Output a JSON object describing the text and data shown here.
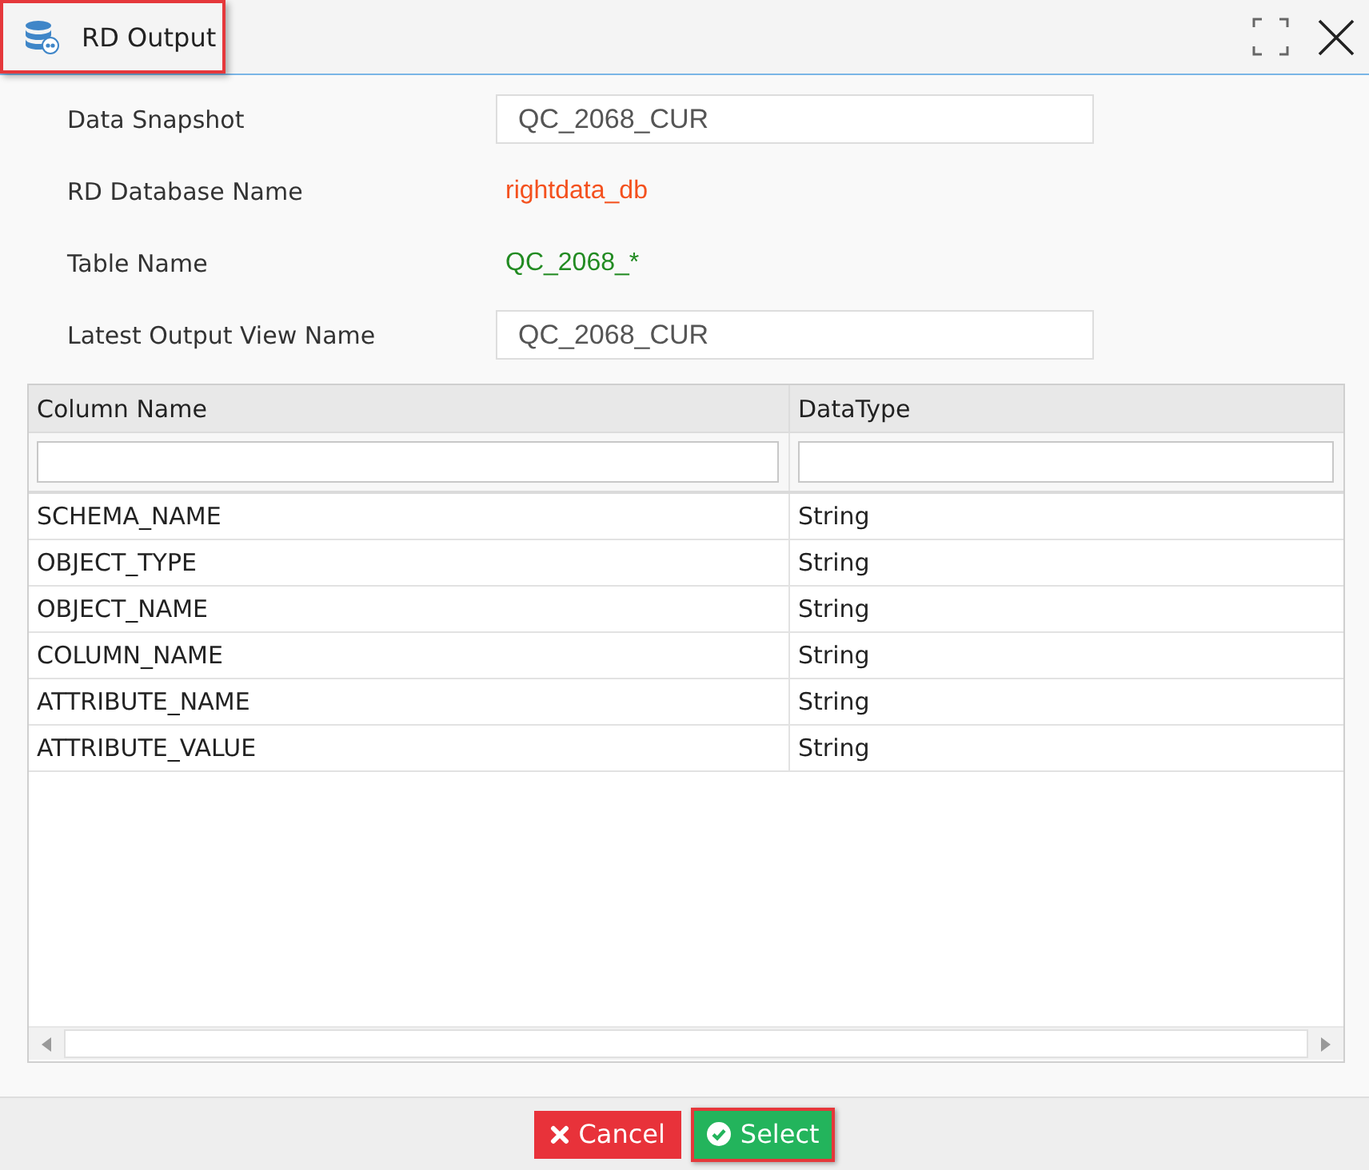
{
  "window": {
    "title": "RD Output",
    "title_highlighted": true
  },
  "fields": [
    {
      "label": "Data Snapshot",
      "kind": "input",
      "value": "QC_2068_CUR"
    },
    {
      "label": "RD Database Name",
      "kind": "text",
      "value": "rightdata_db",
      "color": "#f4511e"
    },
    {
      "label": "Table Name",
      "kind": "text",
      "value": "QC_2068_*",
      "color": "#228b22"
    },
    {
      "label": "Latest Output View Name",
      "kind": "input",
      "value": "QC_2068_CUR"
    }
  ],
  "table": {
    "columns": [
      {
        "label": "Column Name"
      },
      {
        "label": "DataType"
      }
    ],
    "rows": [
      [
        "SCHEMA_NAME",
        "String"
      ],
      [
        "OBJECT_TYPE",
        "String"
      ],
      [
        "OBJECT_NAME",
        "String"
      ],
      [
        "COLUMN_NAME",
        "String"
      ],
      [
        "ATTRIBUTE_NAME",
        "String"
      ],
      [
        "ATTRIBUTE_VALUE",
        "String"
      ]
    ]
  },
  "buttons": [
    {
      "label": "Cancel",
      "kind": "cancel",
      "highlighted": false
    },
    {
      "label": "Select",
      "kind": "select",
      "highlighted": true
    }
  ]
}
